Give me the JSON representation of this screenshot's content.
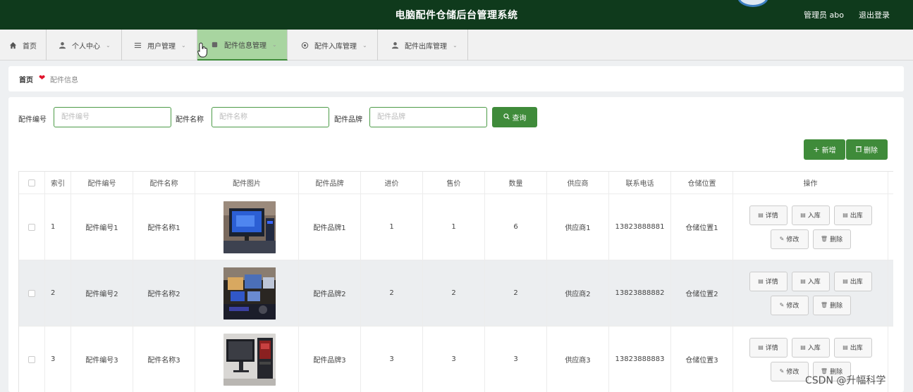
{
  "header": {
    "title": "电脑配件仓储后台管理系统",
    "user": "管理员 abo",
    "logout": "退出登录"
  },
  "nav": {
    "home": "首页",
    "personal": "个人中心",
    "users": "用户管理",
    "parts_info": "配件信息管理",
    "parts_in": "配件入库管理",
    "parts_out": "配件出库管理"
  },
  "breadcrumb": {
    "home": "首页",
    "current": "配件信息"
  },
  "search": {
    "code_label": "配件编号",
    "code_placeholder": "配件编号",
    "name_label": "配件名称",
    "name_placeholder": "配件名称",
    "brand_label": "配件品牌",
    "brand_placeholder": "配件品牌",
    "query": "查询"
  },
  "actions": {
    "add": "新增",
    "delete": "删除"
  },
  "table": {
    "headers": {
      "index": "索引",
      "code": "配件编号",
      "name": "配件名称",
      "image": "配件图片",
      "brand": "配件品牌",
      "cost": "进价",
      "price": "售价",
      "qty": "数量",
      "supplier": "供应商",
      "phone": "联系电话",
      "location": "仓储位置",
      "ops": "操作"
    },
    "ops": {
      "detail": "详情",
      "in": "入库",
      "out": "出库",
      "edit": "修改",
      "remove": "删除"
    },
    "rows": [
      {
        "index": "1",
        "code": "配件编号1",
        "name": "配件名称1",
        "brand": "配件品牌1",
        "cost": "1",
        "price": "1",
        "qty": "6",
        "supplier": "供应商1",
        "phone": "13823888881",
        "location": "仓储位置1"
      },
      {
        "index": "2",
        "code": "配件编号2",
        "name": "配件名称2",
        "brand": "配件品牌2",
        "cost": "2",
        "price": "2",
        "qty": "2",
        "supplier": "供应商2",
        "phone": "13823888882",
        "location": "仓储位置2"
      },
      {
        "index": "3",
        "code": "配件编号3",
        "name": "配件名称3",
        "brand": "配件品牌3",
        "cost": "3",
        "price": "3",
        "qty": "3",
        "supplier": "供应商3",
        "phone": "13823888883",
        "location": "仓储位置3"
      }
    ]
  },
  "watermark": "CSDN @升幅科学",
  "colors": {
    "header_bg": "#0f3a1c",
    "accent": "#3f8b3a",
    "nav_active": "#a8d5a0",
    "heart": "#e0142c"
  }
}
